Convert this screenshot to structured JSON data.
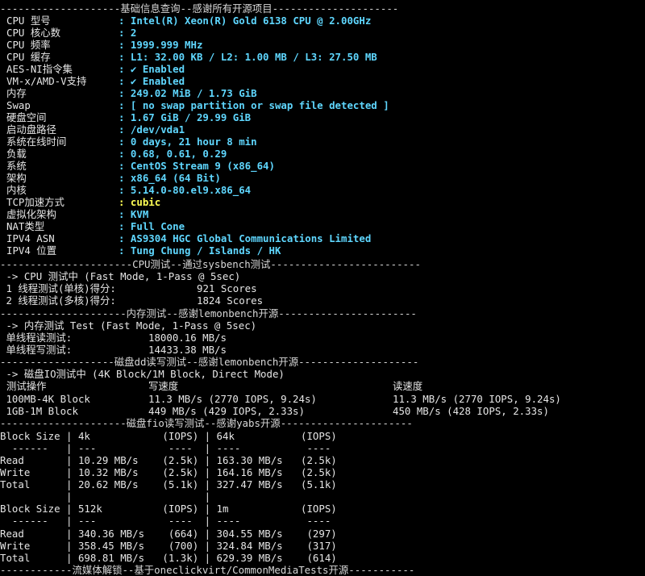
{
  "colors": {
    "background": "#000000",
    "text": "#e6e6e6",
    "value_cyan": "#5fd7ff",
    "value_yellow": "#ffff55"
  },
  "basic": {
    "header": "--------------------基础信息查询--感谢所有开源项目---------------------",
    "rows": [
      {
        "label": "CPU 型号",
        "value": ": Intel(R) Xeon(R) Gold 6138 CPU @ 2.00GHz",
        "color": "cyan"
      },
      {
        "label": "CPU 核心数",
        "value": ": 2",
        "color": "cyan"
      },
      {
        "label": "CPU 频率",
        "value": ": 1999.999 MHz",
        "color": "cyan"
      },
      {
        "label": "CPU 缓存",
        "value": ": L1: 32.00 KB / L2: 1.00 MB / L3: 27.50 MB",
        "color": "cyan"
      },
      {
        "label": "AES-NI指令集",
        "value": ": ✔ Enabled",
        "color": "cyan"
      },
      {
        "label": "VM-x/AMD-V支持",
        "value": ": ✔ Enabled",
        "color": "cyan"
      },
      {
        "label": "内存",
        "value": ": 249.02 MiB / 1.73 GiB",
        "color": "cyan"
      },
      {
        "label": "Swap",
        "value": ": [ no swap partition or swap file detected ]",
        "color": "cyan"
      },
      {
        "label": "硬盘空间",
        "value": ": 1.67 GiB / 29.99 GiB",
        "color": "cyan"
      },
      {
        "label": "启动盘路径",
        "value": ": /dev/vda1",
        "color": "cyan"
      },
      {
        "label": "系统在线时间",
        "value": ": 0 days, 21 hour 8 min",
        "color": "cyan"
      },
      {
        "label": "负载",
        "value": ": 0.68, 0.61, 0.29",
        "color": "cyan"
      },
      {
        "label": "系统",
        "value": ": CentOS Stream 9 (x86_64)",
        "color": "cyan"
      },
      {
        "label": "架构",
        "value": ": x86_64 (64 Bit)",
        "color": "cyan"
      },
      {
        "label": "内核",
        "value": ": 5.14.0-80.el9.x86_64",
        "color": "cyan"
      },
      {
        "label": "TCP加速方式",
        "value": ": cubic",
        "color": "yellow"
      },
      {
        "label": "虚拟化架构",
        "value": ": KVM",
        "color": "cyan"
      },
      {
        "label": "NAT类型",
        "value": ": Full Cone",
        "color": "cyan"
      },
      {
        "label": "IPV4 ASN",
        "value": ": AS9304 HGC Global Communications Limited",
        "color": "cyan"
      },
      {
        "label": "IPV4 位置",
        "value": ": Tung Chung / Islands / HK",
        "color": "cyan"
      }
    ]
  },
  "cpu_test": {
    "header": "----------------------CPU测试--通过sysbench测试-------------------------",
    "mode": " -> CPU 测试中 (Fast Mode, 1-Pass @ 5sec)",
    "rows": [
      {
        "label": " 1 线程测试(单核)得分:",
        "value": "921 Scores"
      },
      {
        "label": " 2 线程测试(多核)得分:",
        "value": "1824 Scores"
      }
    ]
  },
  "mem_test": {
    "header": "---------------------内存测试--感谢lemonbench开源-----------------------",
    "mode": " -> 内存测试 Test (Fast Mode, 1-Pass @ 5sec)",
    "rows": [
      {
        "label": " 单线程读测试:",
        "value": "18000.16 MB/s"
      },
      {
        "label": " 单线程写测试:",
        "value": "14433.38 MB/s"
      }
    ]
  },
  "dd_test": {
    "header": "-------------------磁盘dd读写测试--感谢lemonbench开源--------------------",
    "mode": " -> 磁盘IO测试中 (4K Block/1M Block, Direct Mode)",
    "columns": [
      "测试操作",
      "写速度",
      "读速度"
    ],
    "rows": [
      {
        "op": " 100MB-4K Block",
        "write": "11.3 MB/s (2770 IOPS, 9.24s)",
        "read": "11.3 MB/s (2770 IOPS, 9.24s)"
      },
      {
        "op": " 1GB-1M Block",
        "write": "449 MB/s (429 IOPS, 2.33s)",
        "read": "450 MB/s (428 IOPS, 2.33s)"
      }
    ]
  },
  "fio_test": {
    "header": "---------------------磁盘fio读写测试--感谢yabs开源----------------------",
    "lines": [
      "Block Size | 4k            (IOPS) | 64k           (IOPS)",
      "  ------   | ---            ----  | ----           ----",
      "Read       | 10.29 MB/s    (2.5k) | 163.30 MB/s   (2.5k)",
      "Write      | 10.32 MB/s    (2.5k) | 164.16 MB/s   (2.5k)",
      "Total      | 20.62 MB/s    (5.1k) | 327.47 MB/s   (5.1k)",
      "           |                      |",
      "Block Size | 512k          (IOPS) | 1m            (IOPS)",
      "  ------   | ---            ----  | ----           ----",
      "Read       | 340.36 MB/s    (664) | 304.55 MB/s    (297)",
      "Write      | 358.45 MB/s    (700) | 324.84 MB/s    (317)",
      "Total      | 698.81 MB/s   (1.3k) | 629.39 MB/s    (614)"
    ]
  },
  "media_test": {
    "header": "------------流媒体解锁--基于oneclickvirt/CommonMediaTests开源-----------"
  }
}
